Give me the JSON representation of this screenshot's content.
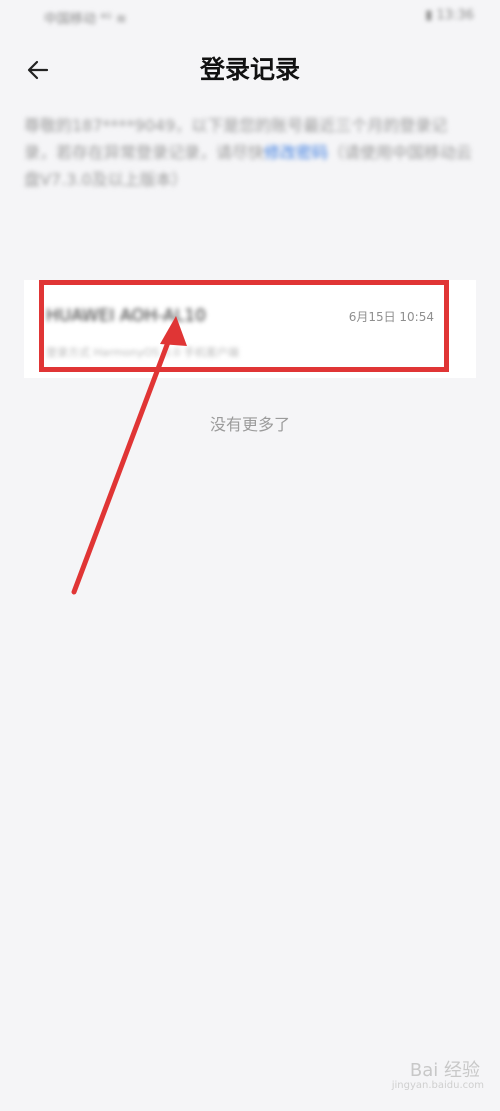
{
  "status_bar": {
    "carrier": "中国移动 ⁴ᴳ ≋",
    "battery_time": "▮ 13:36"
  },
  "header": {
    "title": "登录记录"
  },
  "intro": {
    "text_before": "尊敬的187****9049，以下是您的账号最近三个月的登录记录，若存在异常登录记录，请尽快",
    "link_text": "修改密码",
    "text_after": "（请使用中国移动云盘V7.3.0及以上版本）"
  },
  "records": [
    {
      "device": "HUAWEI AOH-AL10",
      "time": "6月15日 10:54",
      "detail": "登录方式 HarmonyOS 3.0 手机客户端"
    }
  ],
  "list_footer": {
    "no_more": "没有更多了"
  },
  "watermark": {
    "logo": "Bai 经验",
    "url": "jingyan.baidu.com"
  },
  "colors": {
    "annotation": "#e03535",
    "link": "#3d7de0",
    "background": "#f5f5f7"
  }
}
